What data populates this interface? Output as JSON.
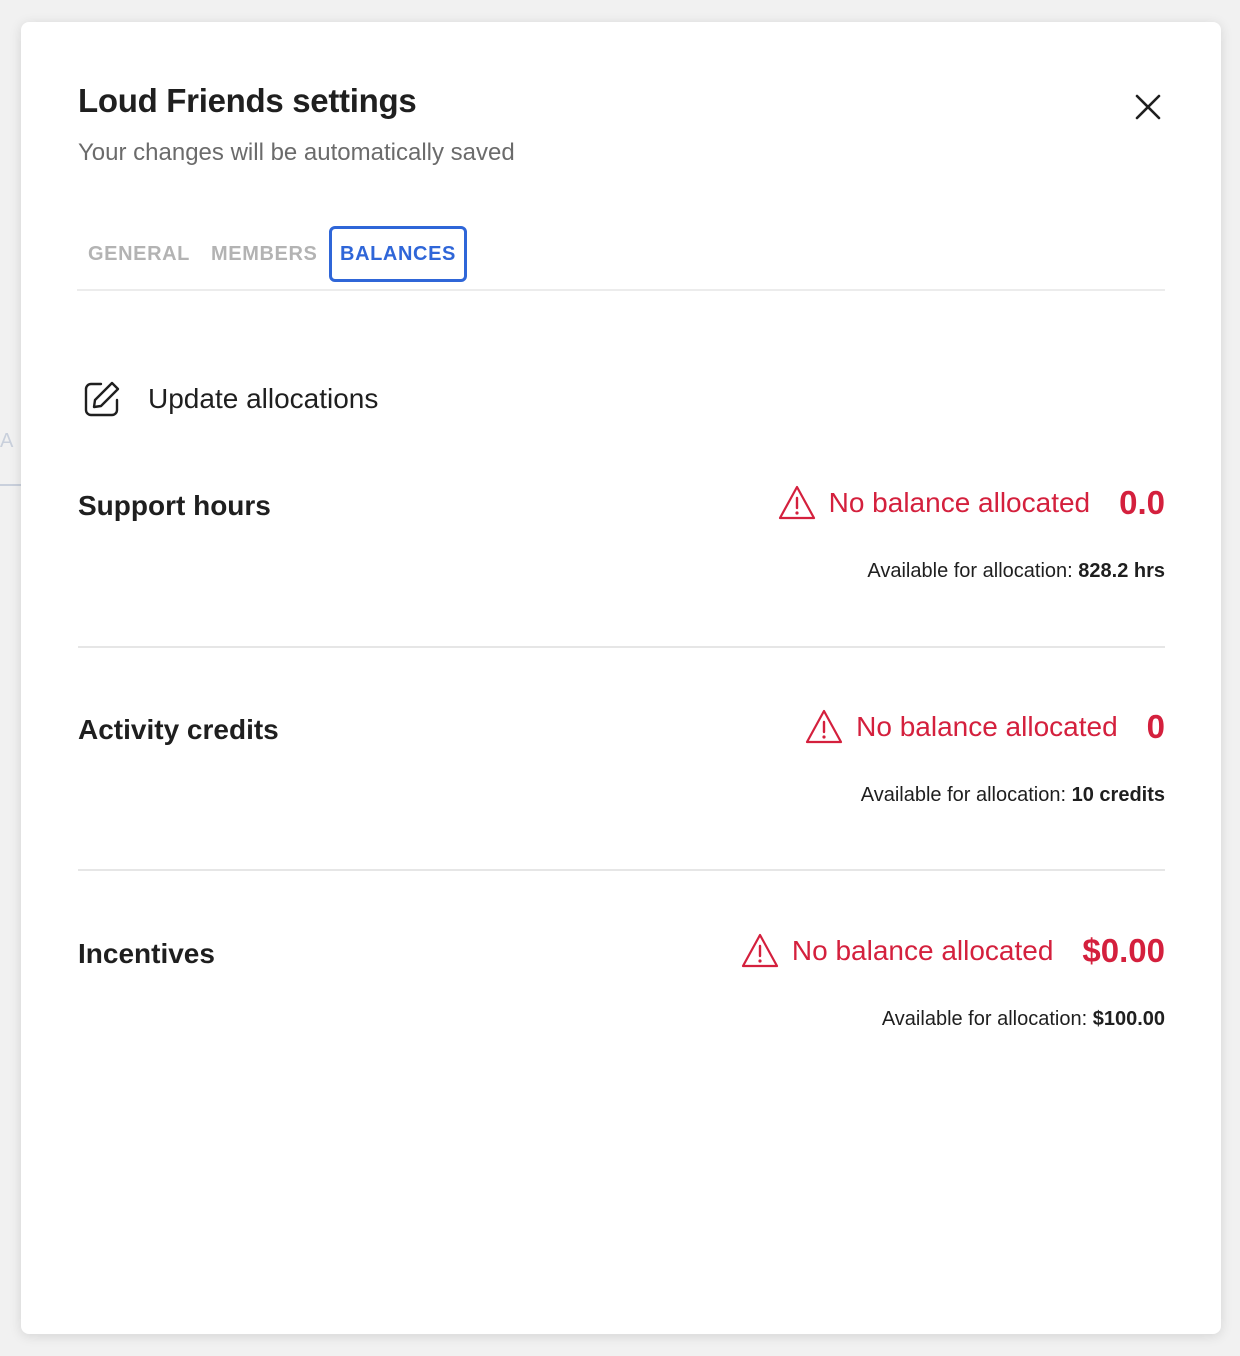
{
  "backdrop": {
    "hint_text": "A"
  },
  "modal": {
    "title": "Loud Friends settings",
    "subtitle": "Your changes will be automatically saved",
    "close_icon": "close-icon"
  },
  "tabs": {
    "items": [
      {
        "label": "GENERAL",
        "active": false
      },
      {
        "label": "MEMBERS",
        "active": false
      },
      {
        "label": "BALANCES",
        "active": true
      }
    ]
  },
  "actions": {
    "update_allocations_label": "Update allocations",
    "update_icon": "edit-icon"
  },
  "balances": [
    {
      "name": "Support hours",
      "status": "No balance allocated",
      "value": "0.0",
      "available_label": "Available for allocation:",
      "available_value": "828.2 hrs"
    },
    {
      "name": "Activity credits",
      "status": "No balance allocated",
      "value": "0",
      "available_label": "Available for allocation:",
      "available_value": "10 credits"
    },
    {
      "name": "Incentives",
      "status": "No balance allocated",
      "value": "$0.00",
      "available_label": "Available for allocation:",
      "available_value": "$100.00"
    }
  ],
  "colors": {
    "accent": "#2f66d8",
    "warning": "#d4203d",
    "text": "#1f1f1f",
    "muted": "#6b6b6b"
  }
}
